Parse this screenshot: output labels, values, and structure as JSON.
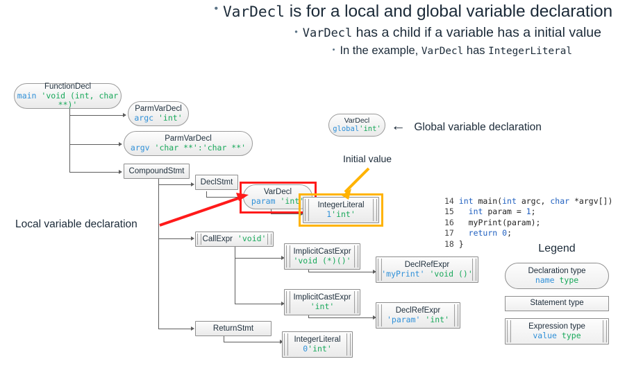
{
  "slide": {
    "bullets": [
      {
        "marker": "•",
        "parts": [
          {
            "text": "VarDecl",
            "mono": true
          },
          {
            "text": " is for a local and global variable declaration",
            "mono": false
          }
        ]
      },
      {
        "marker": "•",
        "parts": [
          {
            "text": "VarDecl",
            "mono": true
          },
          {
            "text": " has a child if a variable has a initial value",
            "mono": false
          }
        ]
      },
      {
        "marker": "•",
        "parts": [
          {
            "text": "In the example, ",
            "mono": false
          },
          {
            "text": "VarDecl",
            "mono": true
          },
          {
            "text": " has ",
            "mono": false
          },
          {
            "text": "IntegerLiteral",
            "mono": true
          }
        ]
      }
    ]
  },
  "colors": {
    "name_blue": "#2f90d8",
    "type_green": "#18a85a",
    "highlight_red": "#ff1a1a",
    "highlight_orange": "#ffb300",
    "code_keyword": "#2060c0",
    "connector_gray": "#5d5d5d"
  },
  "ast": {
    "nodes": [
      {
        "id": "function-decl",
        "kind": "declaration",
        "title": "FunctionDecl",
        "name": "main",
        "type": "'void (int, char **)'"
      },
      {
        "id": "parm-var-decl-argc",
        "kind": "declaration",
        "title": "ParmVarDecl",
        "name": "argc",
        "type": "'int'"
      },
      {
        "id": "parm-var-decl-argv",
        "kind": "declaration",
        "title": "ParmVarDecl",
        "name": "argv",
        "type": "'char **':'char **'"
      },
      {
        "id": "compound-stmt",
        "kind": "statement",
        "title": "CompoundStmt"
      },
      {
        "id": "decl-stmt",
        "kind": "statement",
        "title": "DeclStmt"
      },
      {
        "id": "var-decl-param",
        "kind": "declaration",
        "title": "VarDecl",
        "name": "param",
        "type": "'int'"
      },
      {
        "id": "integer-literal-1",
        "kind": "expression",
        "title": "IntegerLiteral",
        "value": "1",
        "type": "'int'"
      },
      {
        "id": "var-decl-global",
        "kind": "declaration",
        "title": "VarDecl",
        "name": "global",
        "type": "'int'"
      },
      {
        "id": "call-expr",
        "kind": "expression",
        "title": "CallExpr",
        "type": "'void'"
      },
      {
        "id": "implicit-cast-expr-void",
        "kind": "expression",
        "title": "ImplicitCastExpr",
        "type": "'void (*)()'"
      },
      {
        "id": "decl-ref-expr-myprint",
        "kind": "expression",
        "title": "DeclRefExpr",
        "value": "'myPrint'",
        "type": "'void ()'"
      },
      {
        "id": "implicit-cast-expr-int",
        "kind": "expression",
        "title": "ImplicitCastExpr",
        "type": "'int'"
      },
      {
        "id": "decl-ref-expr-param",
        "kind": "expression",
        "title": "DeclRefExpr",
        "value": "'param'",
        "type": "'int'"
      },
      {
        "id": "return-stmt",
        "kind": "statement",
        "title": "ReturnStmt"
      },
      {
        "id": "integer-literal-0",
        "kind": "expression",
        "title": "IntegerLiteral",
        "value": "0",
        "type": "'int'"
      }
    ]
  },
  "annotations": {
    "global_var": "Global variable declaration",
    "local_var": "Local variable declaration",
    "initial_value": "Initial value",
    "global_arrow": "←"
  },
  "code": {
    "lines": [
      {
        "no": "14",
        "tokens": [
          {
            "t": "int",
            "c": "kw"
          },
          {
            "t": " main(",
            "c": ""
          },
          {
            "t": "int",
            "c": "kw"
          },
          {
            "t": " argc, ",
            "c": ""
          },
          {
            "t": "char",
            "c": "kw"
          },
          {
            "t": " *argv[]) {",
            "c": ""
          }
        ]
      },
      {
        "no": "15",
        "tokens": [
          {
            "t": "  ",
            "c": ""
          },
          {
            "t": "int",
            "c": "kw"
          },
          {
            "t": " param = ",
            "c": ""
          },
          {
            "t": "1",
            "c": "num"
          },
          {
            "t": ";",
            "c": ""
          }
        ]
      },
      {
        "no": "16",
        "tokens": [
          {
            "t": "  myPrint(param);",
            "c": ""
          }
        ]
      },
      {
        "no": "17",
        "tokens": [
          {
            "t": "  ",
            "c": ""
          },
          {
            "t": "return",
            "c": "kw"
          },
          {
            "t": " ",
            "c": ""
          },
          {
            "t": "0",
            "c": "num"
          },
          {
            "t": ";",
            "c": ""
          }
        ]
      },
      {
        "no": "18",
        "tokens": [
          {
            "t": "}",
            "c": ""
          }
        ]
      }
    ]
  },
  "legend": {
    "title": "Legend",
    "items": [
      {
        "kind": "declaration",
        "label": "Declaration type",
        "name": "name",
        "type": "type"
      },
      {
        "kind": "statement",
        "label": "Statement type"
      },
      {
        "kind": "expression",
        "label": "Expression type",
        "name": "value",
        "type": "type"
      }
    ]
  }
}
